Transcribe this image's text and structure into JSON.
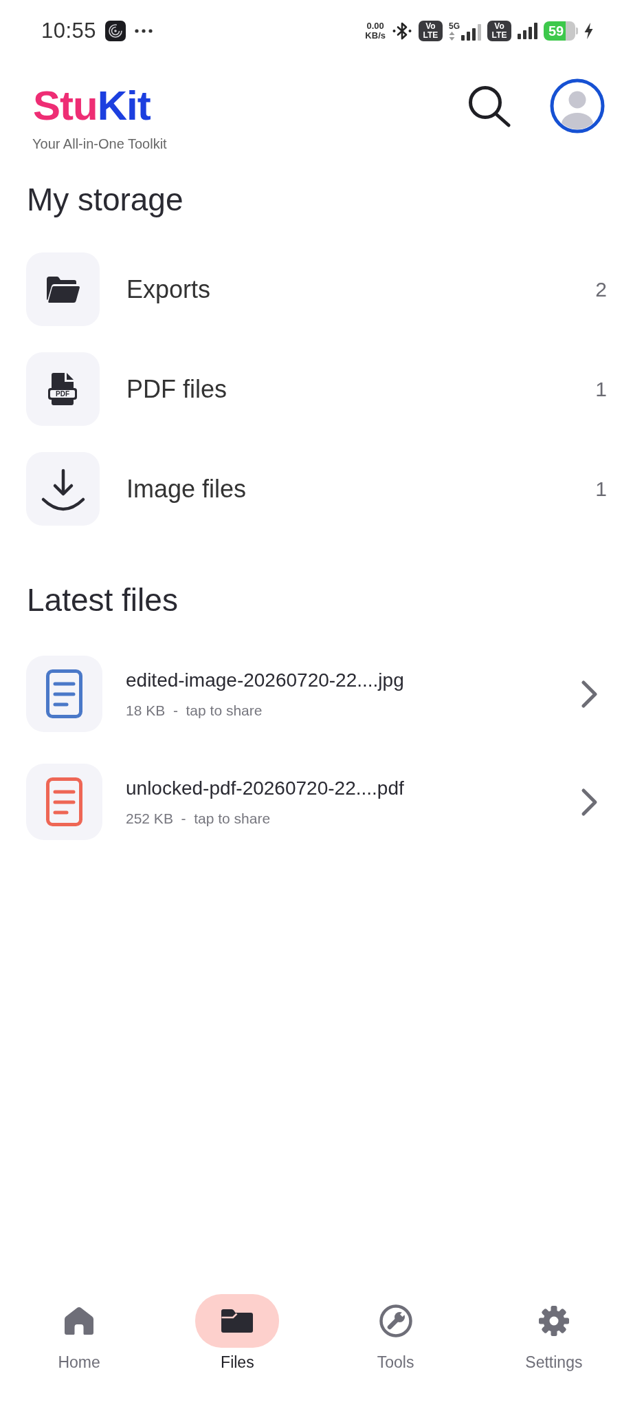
{
  "status_bar": {
    "time": "10:55",
    "indicators": [
      {
        "kind": "speed",
        "value": "0.00",
        "unit": "KB/s"
      },
      {
        "kind": "bluetooth"
      },
      {
        "kind": "volte",
        "line_1": "Vo",
        "line_2": "LTE"
      },
      {
        "kind": "signal",
        "network": "5G"
      },
      {
        "kind": "volte",
        "line_1": "Vo",
        "line_2": "LTE"
      },
      {
        "kind": "signal"
      },
      {
        "kind": "battery",
        "percent": "59",
        "charging": true
      }
    ]
  },
  "header": {
    "logo": [
      {
        "text": "Stu",
        "color": "#ee2d74"
      },
      {
        "text": "Kit",
        "color": "#1c3fdf"
      }
    ],
    "tagline": "Your All-in-One Toolkit"
  },
  "storage": {
    "title": "My storage",
    "items": [
      {
        "kind": "folder",
        "label": "Exports",
        "count": "2"
      },
      {
        "kind": "pdf",
        "icon_text": "PDF",
        "label": "PDF files",
        "count": "1"
      },
      {
        "kind": "download",
        "label": "Image files",
        "count": "1"
      }
    ]
  },
  "latest_files": {
    "title": "Latest files",
    "items": [
      {
        "name": "edited-image-20260720-22....jpg",
        "details": "18 KB  -  tap to share",
        "color": "#4a78c8"
      },
      {
        "name": "unlocked-pdf-20260720-22....pdf",
        "details": "252 KB  -  tap to share",
        "color": "#ee6655"
      }
    ]
  },
  "bottom_nav": [
    {
      "kind": "home",
      "label": "Home",
      "selected": false
    },
    {
      "kind": "files",
      "label": "Files",
      "selected": true
    },
    {
      "kind": "tools",
      "label": "Tools",
      "selected": false
    },
    {
      "kind": "settings",
      "label": "Settings",
      "selected": false
    }
  ]
}
